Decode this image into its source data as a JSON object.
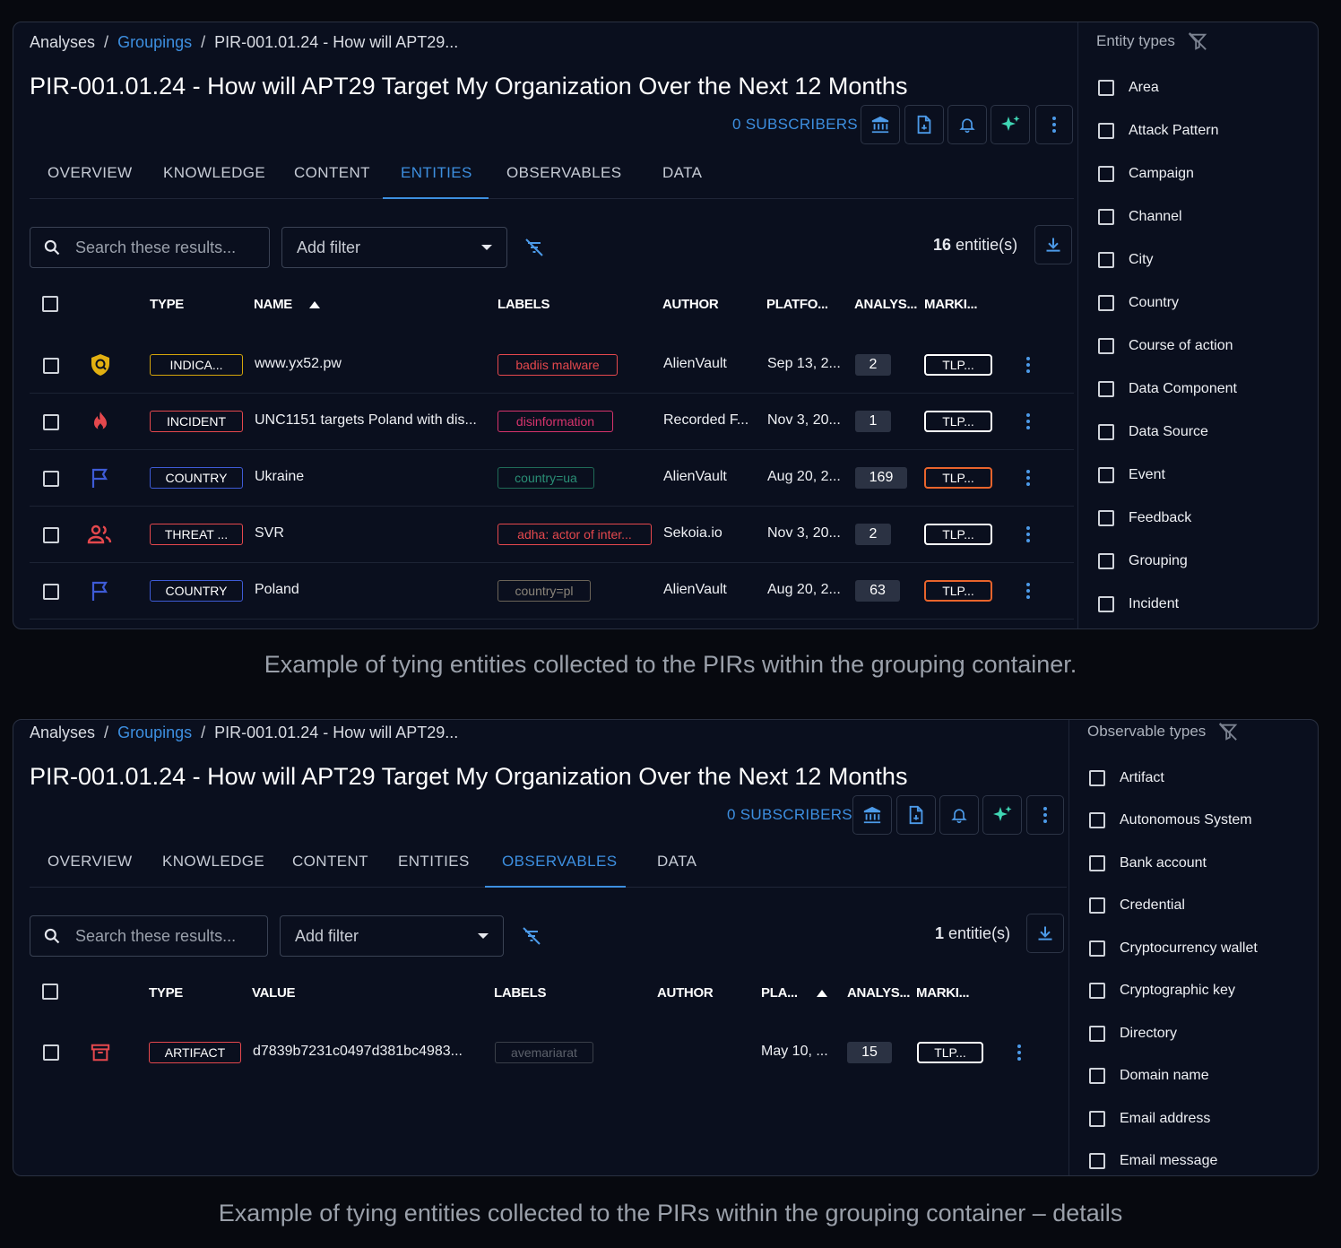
{
  "screen1": {
    "breadcrumb": {
      "first": "Analyses",
      "second": "Groupings",
      "third": "PIR-001.01.24 - How will APT29..."
    },
    "title": "PIR-001.01.24 - How will APT29 Target My Organization Over the Next 12 Months",
    "subscribers": "0 SUBSCRIBERS",
    "tabs": [
      "OVERVIEW",
      "KNOWLEDGE",
      "CONTENT",
      "ENTITIES",
      "OBSERVABLES",
      "DATA"
    ],
    "active_tab": "ENTITIES",
    "search_placeholder": "Search these results...",
    "filter_label": "Add filter",
    "count_num": "16",
    "count_label": "entitie(s)",
    "headers": {
      "type": "TYPE",
      "name": "NAME",
      "labels": "LABELS",
      "author": "AUTHOR",
      "platform": "PLATFO...",
      "analyses": "ANALYS...",
      "marking": "MARKI..."
    },
    "rows": [
      {
        "icon": "indicator-shield-icon",
        "type": "INDICA...",
        "name": "www.yx52.pw",
        "label": "badiis malware",
        "author": "AlienVault",
        "date": "Sep 13, 2...",
        "count": "2",
        "marking": "TLP..."
      },
      {
        "icon": "incident-fire-icon",
        "type": "INCIDENT",
        "name": "UNC1151 targets Poland with dis...",
        "label": "disinformation",
        "author": "Recorded F...",
        "date": "Nov 3, 20...",
        "count": "1",
        "marking": "TLP..."
      },
      {
        "icon": "country-flag-icon",
        "type": "COUNTRY",
        "name": "Ukraine",
        "label": "country=ua",
        "author": "AlienVault",
        "date": "Aug 20, 2...",
        "count": "169",
        "marking": "TLP..."
      },
      {
        "icon": "threat-actor-people-icon",
        "type": "THREAT ...",
        "name": "SVR",
        "label": "adha: actor of inter...",
        "author": "Sekoia.io",
        "date": "Nov 3, 20...",
        "count": "2",
        "marking": "TLP..."
      },
      {
        "icon": "country-flag-icon",
        "type": "COUNTRY",
        "name": "Poland",
        "label": "country=pl",
        "author": "AlienVault",
        "date": "Aug 20, 2...",
        "count": "63",
        "marking": "TLP..."
      }
    ],
    "sidebar": {
      "title": "Entity types",
      "items": [
        "Area",
        "Attack Pattern",
        "Campaign",
        "Channel",
        "City",
        "Country",
        "Course of action",
        "Data Component",
        "Data Source",
        "Event",
        "Feedback",
        "Grouping",
        "Incident"
      ]
    }
  },
  "caption1": "Example of tying entities collected to the PIRs within the grouping container.",
  "screen2": {
    "breadcrumb": {
      "first": "Analyses",
      "second": "Groupings",
      "third": "PIR-001.01.24 - How will APT29..."
    },
    "title": "PIR-001.01.24 - How will APT29 Target My Organization Over the Next 12 Months",
    "subscribers": "0 SUBSCRIBERS",
    "tabs": [
      "OVERVIEW",
      "KNOWLEDGE",
      "CONTENT",
      "ENTITIES",
      "OBSERVABLES",
      "DATA"
    ],
    "active_tab": "OBSERVABLES",
    "search_placeholder": "Search these results...",
    "filter_label": "Add filter",
    "count_num": "1",
    "count_label": "entitie(s)",
    "headers": {
      "type": "TYPE",
      "value": "VALUE",
      "labels": "LABELS",
      "author": "AUTHOR",
      "platform": "PLA...",
      "analyses": "ANALYS...",
      "marking": "MARKI..."
    },
    "rows": [
      {
        "icon": "artifact-archive-icon",
        "type": "ARTIFACT",
        "value": "d7839b7231c0497d381bc4983...",
        "label": "avemariarat",
        "author": "",
        "date": "May 10, ...",
        "count": "15",
        "marking": "TLP..."
      }
    ],
    "sidebar": {
      "title": "Observable types",
      "items": [
        "Artifact",
        "Autonomous System",
        "Bank account",
        "Credential",
        "Cryptocurrency wallet",
        "Cryptographic key",
        "Directory",
        "Domain name",
        "Email address",
        "Email message"
      ]
    }
  },
  "caption2": "Example of tying entities collected to the PIRs within the grouping container – details",
  "colors": {
    "accent": "#3d8fe0",
    "danger": "#e5484d",
    "amber": "#e8642c",
    "background": "#0a0f1e"
  }
}
